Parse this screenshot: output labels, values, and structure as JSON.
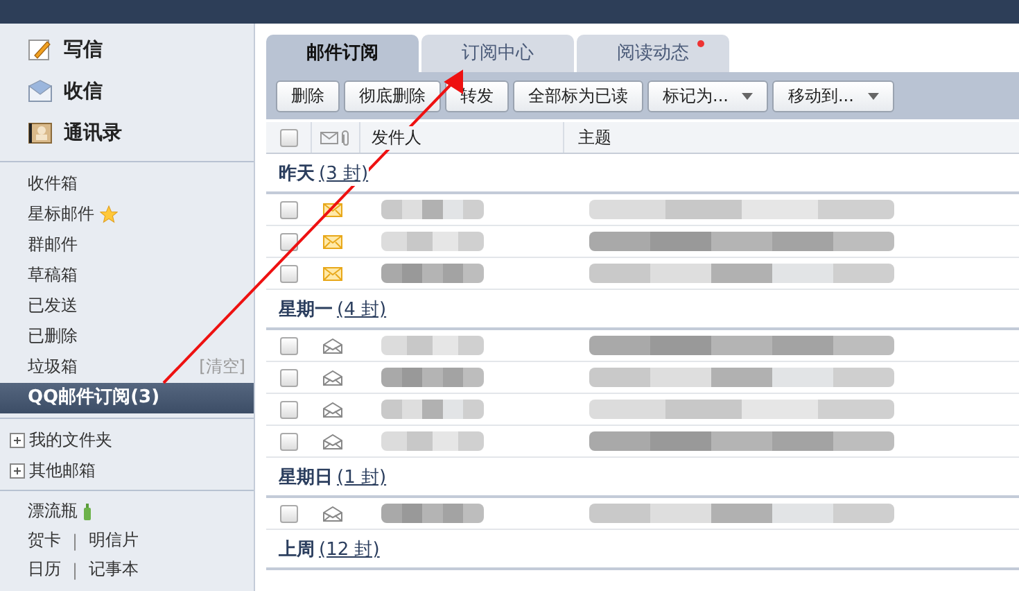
{
  "sidebar": {
    "actions": [
      {
        "kind": "compose",
        "label": "写信"
      },
      {
        "kind": "inbox",
        "label": "收信"
      },
      {
        "kind": "contacts",
        "label": "通讯录"
      }
    ],
    "folders": [
      {
        "label": "收件箱",
        "selected": false
      },
      {
        "label": "星标邮件",
        "selected": false,
        "starred": true
      },
      {
        "label": "群邮件",
        "selected": false
      },
      {
        "label": "草稿箱",
        "selected": false
      },
      {
        "label": "已发送",
        "selected": false
      },
      {
        "label": "已删除",
        "selected": false
      },
      {
        "label": "垃圾箱",
        "selected": false,
        "action": "[清空]"
      },
      {
        "label": "QQ邮件订阅(3)",
        "selected": true
      }
    ],
    "groups": [
      {
        "label": "我的文件夹",
        "expanded": false
      },
      {
        "label": "其他邮箱",
        "expanded": false
      }
    ],
    "extras": [
      {
        "items": [
          "漂流瓶"
        ],
        "bottle": true
      },
      {
        "items": [
          "贺卡",
          "明信片"
        ],
        "separator": "|"
      },
      {
        "items": [
          "日历",
          "记事本"
        ],
        "separator": "|"
      }
    ]
  },
  "tabs": [
    {
      "label": "邮件订阅",
      "selected": true,
      "badge": false
    },
    {
      "label": "订阅中心",
      "selected": false,
      "badge": false
    },
    {
      "label": "阅读动态",
      "selected": false,
      "badge": true
    }
  ],
  "toolbar": [
    {
      "label": "删除",
      "dropdown": false
    },
    {
      "label": "彻底删除",
      "dropdown": false
    },
    {
      "label": "转发",
      "dropdown": false
    },
    {
      "label": "全部标为已读",
      "dropdown": false
    },
    {
      "label": "标记为...",
      "dropdown": true
    },
    {
      "label": "移动到...",
      "dropdown": true
    }
  ],
  "table": {
    "select_all": {
      "checked": false
    },
    "columns": [
      "发件人",
      "主题"
    ],
    "sections": [
      {
        "label": "昨天",
        "count": "(3 封)",
        "rows": [
          {
            "unread": true,
            "checked": false
          },
          {
            "unread": true,
            "checked": false
          },
          {
            "unread": true,
            "checked": false
          }
        ]
      },
      {
        "label": "星期一",
        "count": "(4 封)",
        "rows": [
          {
            "unread": false,
            "checked": false
          },
          {
            "unread": false,
            "checked": false
          },
          {
            "unread": false,
            "checked": false
          },
          {
            "unread": false,
            "checked": false
          }
        ]
      },
      {
        "label": "星期日",
        "count": "(1 封)",
        "rows": [
          {
            "unread": false,
            "checked": false
          }
        ]
      },
      {
        "label": "上周",
        "count": "(12 封)"
      }
    ]
  }
}
